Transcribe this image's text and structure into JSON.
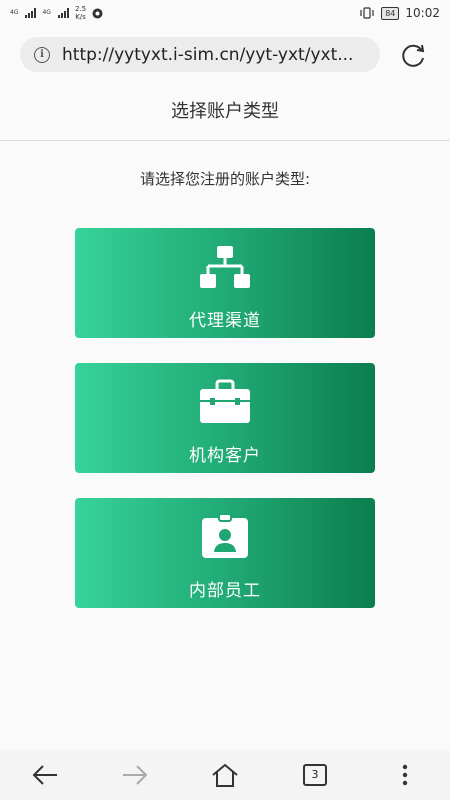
{
  "status_bar": {
    "signal_tag_1": "4G",
    "signal_tag_2": "4G",
    "speed_value": "2.5",
    "speed_unit": "K/s",
    "battery": "84",
    "time": "10:02"
  },
  "browser": {
    "url": "http://yytyxt.i-sim.cn/yyt-yxt/yxt...",
    "info_icon": "info-icon",
    "reload_icon": "reload-icon"
  },
  "page": {
    "title": "选择账户类型",
    "prompt": "请选择您注册的账户类型:",
    "options": [
      {
        "label": "代理渠道",
        "icon": "hierarchy-icon"
      },
      {
        "label": "机构客户",
        "icon": "briefcase-icon"
      },
      {
        "label": "内部员工",
        "icon": "id-badge-icon"
      }
    ]
  },
  "bottom_nav": {
    "tabs_count": "3",
    "items": [
      "back-icon",
      "forward-icon",
      "home-icon",
      "tabs-icon",
      "more-icon"
    ]
  },
  "colors": {
    "card_gradient_start": "#36d39a",
    "card_gradient_end": "#0b7e4e"
  }
}
